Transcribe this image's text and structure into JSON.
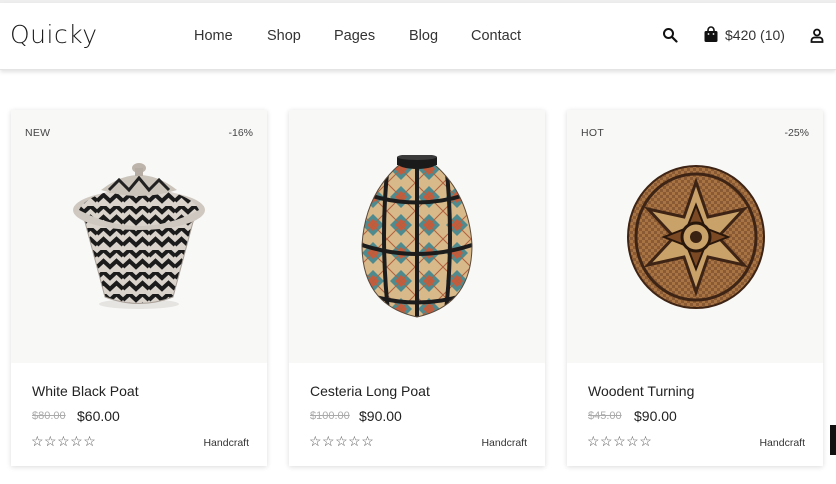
{
  "brand": {
    "logo": "Quicky"
  },
  "nav": {
    "items": [
      "Home",
      "Shop",
      "Pages",
      "Blog",
      "Contact"
    ]
  },
  "header": {
    "search_icon": "search-icon",
    "cart_icon": "shopping-bag-icon",
    "cart_summary": "$420 (10)",
    "account_icon": "user-icon"
  },
  "products": [
    {
      "badge": "NEW",
      "discount": "-16%",
      "title": "White Black Poat",
      "old_price": "$80.00",
      "price": "$60.00",
      "rating_stars": "☆☆☆☆☆",
      "category": "Handcraft"
    },
    {
      "badge": "",
      "discount": "",
      "title": "Cesteria Long Poat",
      "old_price": "$100.00",
      "price": "$90.00",
      "rating_stars": "☆☆☆☆☆",
      "category": "Handcraft"
    },
    {
      "badge": "HOT",
      "discount": "-25%",
      "title": "Woodent Turning",
      "old_price": "$45.00",
      "price": "$90.00",
      "rating_stars": "☆☆☆☆☆",
      "category": "Handcraft"
    }
  ]
}
